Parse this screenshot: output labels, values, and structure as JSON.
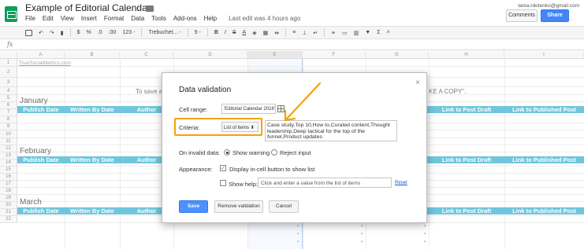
{
  "app": {
    "doc_title": "Example of Editorial Calendar",
    "menu": [
      "File",
      "Edit",
      "View",
      "Insert",
      "Format",
      "Data",
      "Tools",
      "Add-ons",
      "Help"
    ],
    "last_edit": "Last edit was 4 hours ago",
    "user_email": "tania.nikitenko@gmail.com",
    "comments_label": "Comments",
    "share_label": "Share"
  },
  "toolbar": {
    "currency": "$",
    "percent": "%",
    "dec_less": ".0",
    "dec_more": ".00",
    "more_formats": "123 -",
    "font": "Trebuchet... -",
    "font_size": "9 -",
    "bold": "B",
    "italic": "I",
    "strike": "S",
    "text_color": "A"
  },
  "formula_bar": {
    "fx": "fx"
  },
  "grid": {
    "columns": [
      "A",
      "B",
      "C",
      "D",
      "E",
      "F",
      "G",
      "H",
      "I"
    ],
    "rows": [
      "1",
      "2",
      "3",
      "4",
      "5",
      "6",
      "7",
      "8",
      "9",
      "10",
      "11",
      "12",
      "13",
      "14",
      "15",
      "16",
      "17",
      "18",
      "19",
      "20",
      "21",
      "22"
    ],
    "selected_column": "E",
    "link_text": "TrueSocialMetrics.com",
    "row3_left": "To save a",
    "row3_right": "KE A COPY\".",
    "months": [
      "January",
      "February",
      "March"
    ],
    "headers": {
      "publish_date": "Publish Date",
      "written_by": "Written By Date",
      "author": "Author",
      "link_draft": "Link to Post Draft",
      "link_published": "Link to Published Post"
    }
  },
  "dialog": {
    "title": "Data validation",
    "close": "×",
    "cell_range_label": "Cell range:",
    "cell_range_value": "'Editorial Calendar 2016'!",
    "criteria_label": "Criteria:",
    "criteria_select": "List of items ⬍",
    "criteria_values": "Case study,Top 10,How to,Curated content,Thought leadership,Deep tactical for the top of the funnel,Product updates",
    "invalid_label": "On invalid data:",
    "show_warning": "Show warning",
    "reject_input": "Reject input",
    "appearance_label": "Appearance:",
    "display_dropdown": "Display in-cell button to show list",
    "show_help": "Show help:",
    "help_placeholder": "Click and enter a value from the list of items",
    "reset": "Reset",
    "save": "Save",
    "remove": "Remove validation",
    "cancel": "Cancel"
  },
  "colors": {
    "header_blue": "#24a8c9",
    "highlight_orange": "#f4a300",
    "save_blue": "#4d90fe",
    "sheets_green": "#0f9d58"
  },
  "dropdown_marker": "▾"
}
